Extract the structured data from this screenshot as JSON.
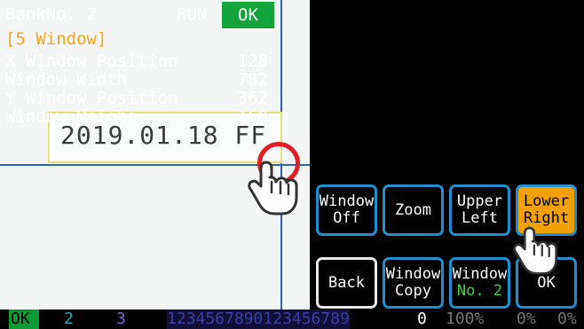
{
  "header": {
    "bank_label": "BankNo. 2",
    "mode": "RUN",
    "judgement": "OK"
  },
  "section_title": "[5 Window]",
  "params": [
    {
      "label": "X Window Position",
      "value": "128"
    },
    {
      "label": "Window Width",
      "value": "782"
    },
    {
      "label": "Y Window Position",
      "value": "362"
    },
    {
      "label": "Window Height",
      "value": "160"
    }
  ],
  "preview": {
    "ocr_text": "2019.01.18 FF"
  },
  "buttons": {
    "window_off": [
      "Window",
      "Off"
    ],
    "zoom": "Zoom",
    "upper_left": [
      "Upper",
      "Left"
    ],
    "lower_right": [
      "Lower",
      "Right"
    ],
    "back": "Back",
    "window_copy": [
      "Window",
      "Copy"
    ],
    "window_no": [
      "Window",
      "No. 2"
    ],
    "ok": "OK"
  },
  "status_bar": {
    "slot1": "OK",
    "slot2": "2",
    "slot3": "3",
    "counter": "1234567890123456789",
    "count": "0",
    "pct1": "100%",
    "pct2": "0%",
    "pct3": "0%"
  },
  "colors": {
    "accent_blue": "#1f8fcf",
    "selected_orange": "#f0a000",
    "ok_green": "#13a53c",
    "section_orange": "#f5a623",
    "guide_red": "#e21d26"
  },
  "icons": {
    "drag_handle": "red-ring-handle-icon",
    "touch_hint": "pointing-hand-icon"
  }
}
